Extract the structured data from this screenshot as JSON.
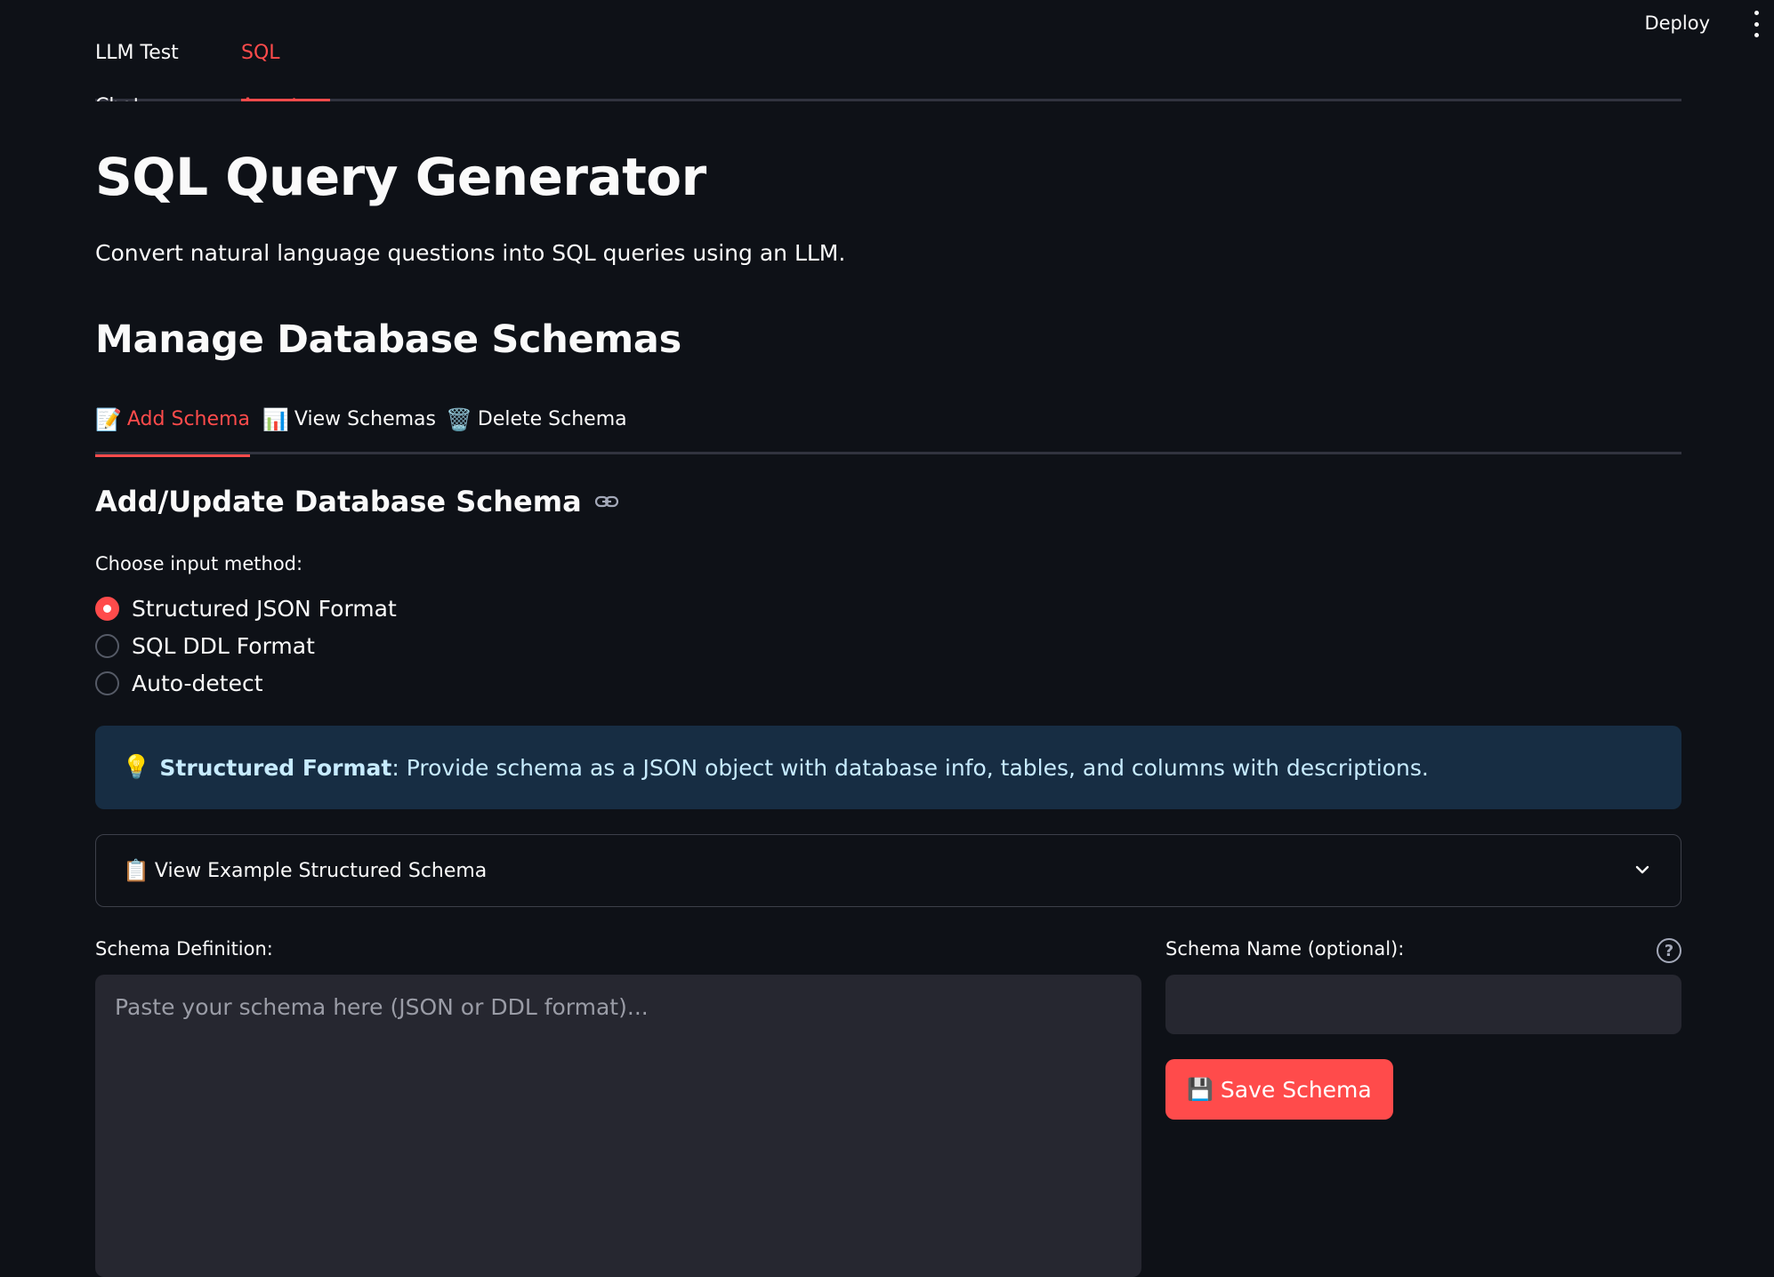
{
  "header": {
    "deploy_label": "Deploy",
    "menu_icon": "kebab-menu-icon"
  },
  "top_tabs": [
    {
      "label": "LLM Test Chat",
      "active": false
    },
    {
      "label": "SQL Agent",
      "active": true
    }
  ],
  "page": {
    "title": "SQL Query Generator",
    "subtitle": "Convert natural language questions into SQL queries using an LLM.",
    "section_title": "Manage Database Schemas"
  },
  "schema_tabs": [
    {
      "icon": "📝",
      "label": "Add Schema",
      "active": true
    },
    {
      "icon": "📊",
      "label": "View Schemas",
      "active": false
    },
    {
      "icon": "🗑️",
      "label": "Delete Schema",
      "active": false
    }
  ],
  "add_schema": {
    "header": "Add/Update Database Schema",
    "input_method_label": "Choose input method:",
    "input_methods": [
      {
        "label": "Structured JSON Format",
        "checked": true
      },
      {
        "label": "SQL DDL Format",
        "checked": false
      },
      {
        "label": "Auto-detect",
        "checked": false
      }
    ],
    "info": {
      "icon": "💡",
      "bold": "Structured Format",
      "text": ": Provide schema as a JSON object with database info, tables, and columns with descriptions."
    },
    "expander": {
      "icon": "📋",
      "label": "View Example Structured Schema"
    },
    "definition_label": "Schema Definition:",
    "definition_placeholder": "Paste your schema here (JSON or DDL format)...",
    "definition_value": "",
    "name_label": "Schema Name (optional):",
    "name_value": "",
    "help_glyph": "?",
    "save_button": {
      "icon": "💾",
      "label": "Save Schema"
    }
  },
  "colors": {
    "background": "#0e1117",
    "accent": "#ff4b4b",
    "info_bg": "#172d43",
    "input_bg": "#262730"
  }
}
